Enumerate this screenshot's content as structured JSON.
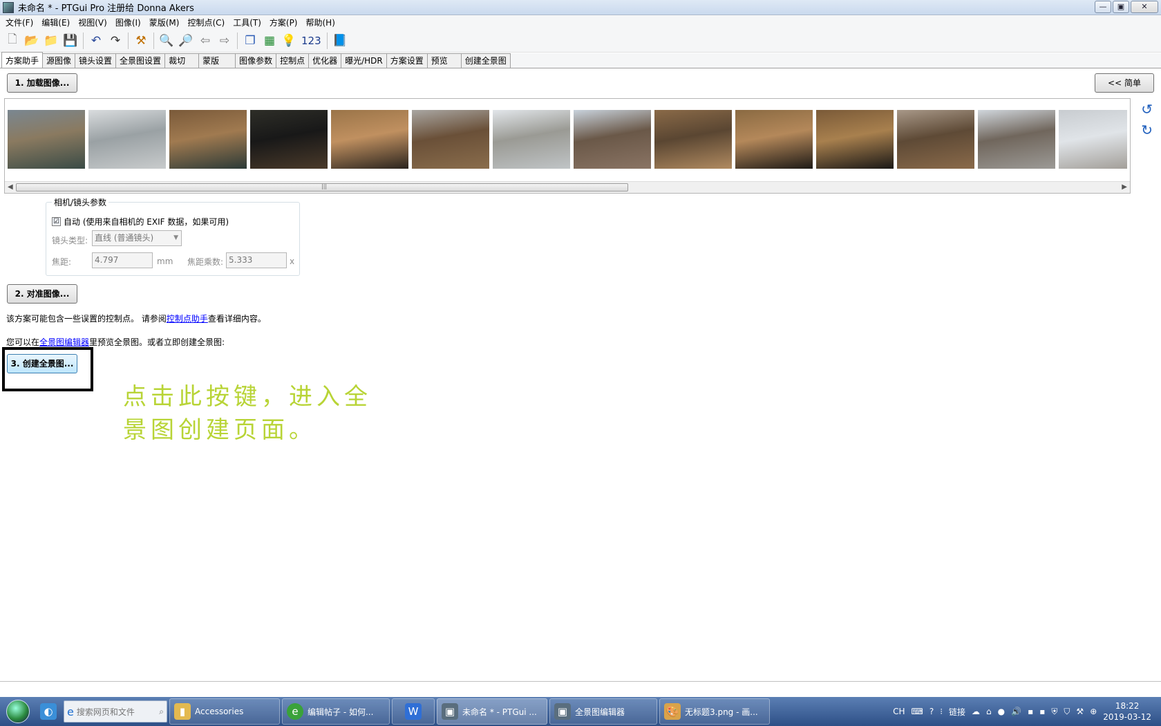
{
  "window": {
    "title": "未命名 * - PTGui Pro 注册给 Donna Akers"
  },
  "menu": [
    "文件(F)",
    "编辑(E)",
    "视图(V)",
    "图像(I)",
    "蒙版(M)",
    "控制点(C)",
    "工具(T)",
    "方案(P)",
    "帮助(H)"
  ],
  "toolbar": {
    "number_label": "123"
  },
  "tabs": [
    "方案助手",
    "源图像",
    "镜头设置",
    "全景图设置",
    "裁切",
    "蒙版",
    "图像参数",
    "控制点",
    "优化器",
    "曝光/HDR",
    "方案设置",
    "预览",
    "创建全景图"
  ],
  "buttons": {
    "load": "1. 加载图像...",
    "simple": "<< 简单",
    "align": "2. 对准图像...",
    "create": "3. 创建全景图..."
  },
  "thumbnails": [
    {
      "colors": [
        "#7a8791",
        "#3a4b46",
        "#8a7a60"
      ]
    },
    {
      "colors": [
        "#d9dcde",
        "#c8cbcc",
        "#9aa1a4"
      ]
    },
    {
      "colors": [
        "#7a5a3a",
        "#2c3a37",
        "#a07a50"
      ]
    },
    {
      "colors": [
        "#2e2e28",
        "#4a3a2a",
        "#181818"
      ]
    },
    {
      "colors": [
        "#9a7448",
        "#2a241e",
        "#c09060"
      ]
    },
    {
      "colors": [
        "#a9a6a2",
        "#8a6d4c",
        "#6a5038"
      ]
    },
    {
      "colors": [
        "#e2e6ea",
        "#c0c4c6",
        "#9a9a94"
      ]
    },
    {
      "colors": [
        "#c8d2dc",
        "#8a7464",
        "#6a5848"
      ]
    },
    {
      "colors": [
        "#8a6a48",
        "#b08a60",
        "#5a4632"
      ]
    },
    {
      "colors": [
        "#8a6a42",
        "#1e1a16",
        "#b4885a"
      ]
    },
    {
      "colors": [
        "#7a5a38",
        "#1a1816",
        "#a8804e"
      ]
    },
    {
      "colors": [
        "#a89888",
        "#8a6a4a",
        "#5e4a36"
      ]
    },
    {
      "colors": [
        "#d0d6dc",
        "#9c9a96",
        "#70665c"
      ]
    },
    {
      "colors": [
        "#c8ccd0",
        "#a09c96",
        "#e0e4e8"
      ]
    }
  ],
  "camera": {
    "legend": "相机/镜头参数",
    "auto_label": "自动 (使用来自相机的 EXIF 数据，如果可用)",
    "auto_checked": "☑",
    "lens_type_label": "镜头类型:",
    "lens_type_value": "直线 (普通镜头)",
    "focal_label": "焦距:",
    "focal_value": "4.797",
    "focal_unit": "mm",
    "factor_label": "焦距乘数:",
    "factor_value": "5.333",
    "factor_unit": "x"
  },
  "notes": {
    "line1_pre": "该方案可能包含一些误置的控制点。 请参阅",
    "line1_link": "控制点助手",
    "line1_post": "查看详细内容。",
    "line2_pre": "您可以在",
    "line2_link": "全景图编辑器",
    "line2_post": "里预览全景图。或者立即创建全景图:"
  },
  "annotation": {
    "line1": "点击此按键，进入全",
    "line2": "景图创建页面。",
    "color": "#b8d436"
  },
  "taskbar": {
    "search_placeholder": "搜索网页和文件",
    "apps": [
      "Accessories",
      "编辑帖子 - 如何...",
      "",
      "未命名 * - PTGui ...",
      "全景图编辑器",
      "无标题3.png - 画..."
    ],
    "lang": "CH",
    "links": "链接",
    "time": "18:22",
    "date": "2019-03-12"
  }
}
